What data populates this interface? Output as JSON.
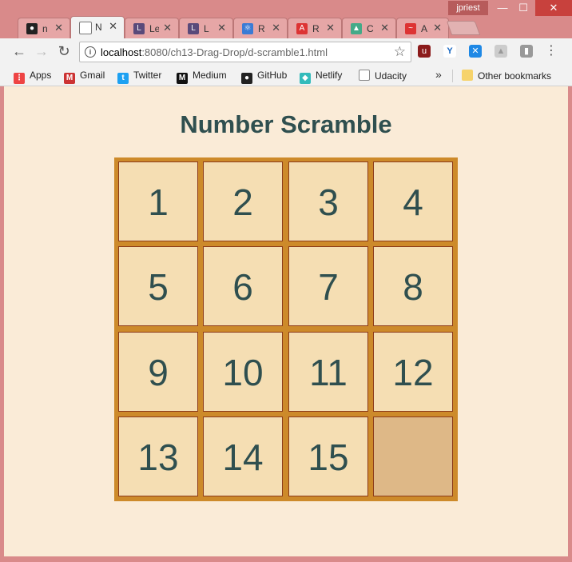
{
  "window": {
    "user": "jpriest",
    "minimize": "—",
    "maximize": "☐",
    "close": "✕"
  },
  "tabs": [
    {
      "title": "n",
      "icon": "github-icon",
      "color": "#222",
      "active": false
    },
    {
      "title": "N",
      "icon": "page-icon",
      "color": "#777",
      "active": true
    },
    {
      "title": "Le",
      "icon": "lambda-icon",
      "color": "#5a4a7a",
      "active": false
    },
    {
      "title": "L",
      "icon": "lambda-icon",
      "color": "#5a4a7a",
      "active": false
    },
    {
      "title": "R",
      "icon": "react-icon",
      "color": "#3a7bd5",
      "active": false
    },
    {
      "title": "R",
      "icon": "angular-icon",
      "color": "#d33",
      "active": false
    },
    {
      "title": "C",
      "icon": "chart-icon",
      "color": "#4a8",
      "active": false
    },
    {
      "title": "A",
      "icon": "pulse-icon",
      "color": "#d33",
      "active": false
    }
  ],
  "toolbar": {
    "back": "←",
    "forward": "→",
    "reload": "↻",
    "url_host": "localhost",
    "url_path": ":8080/ch13-Drag-Drop/d-scramble1.html",
    "star": "☆",
    "menu": "⋮"
  },
  "bookmarks": [
    {
      "label": "Apps",
      "icon": "apps-icon",
      "color": "#e44"
    },
    {
      "label": "Gmail",
      "icon": "gmail-icon",
      "color": "#c33"
    },
    {
      "label": "Twitter",
      "icon": "twitter-icon",
      "color": "#1da1f2"
    },
    {
      "label": "Medium",
      "icon": "medium-icon",
      "color": "#111"
    },
    {
      "label": "GitHub",
      "icon": "github-icon",
      "color": "#222"
    },
    {
      "label": "Netlify",
      "icon": "netlify-icon",
      "color": "#3bb"
    },
    {
      "label": "Udacity",
      "icon": "page-icon",
      "color": "#888"
    }
  ],
  "bookmarks_more": "»",
  "other_bookmarks": "Other bookmarks",
  "page": {
    "title": "Number Scramble",
    "tiles": [
      "1",
      "2",
      "3",
      "4",
      "5",
      "6",
      "7",
      "8",
      "9",
      "10",
      "11",
      "12",
      "13",
      "14",
      "15",
      ""
    ]
  },
  "colors": {
    "page_bg": "#faebd7",
    "title": "#2f4f4f",
    "board": "#cd8a2a",
    "tile": "#f5deb3",
    "empty_tile": "#deb887"
  }
}
